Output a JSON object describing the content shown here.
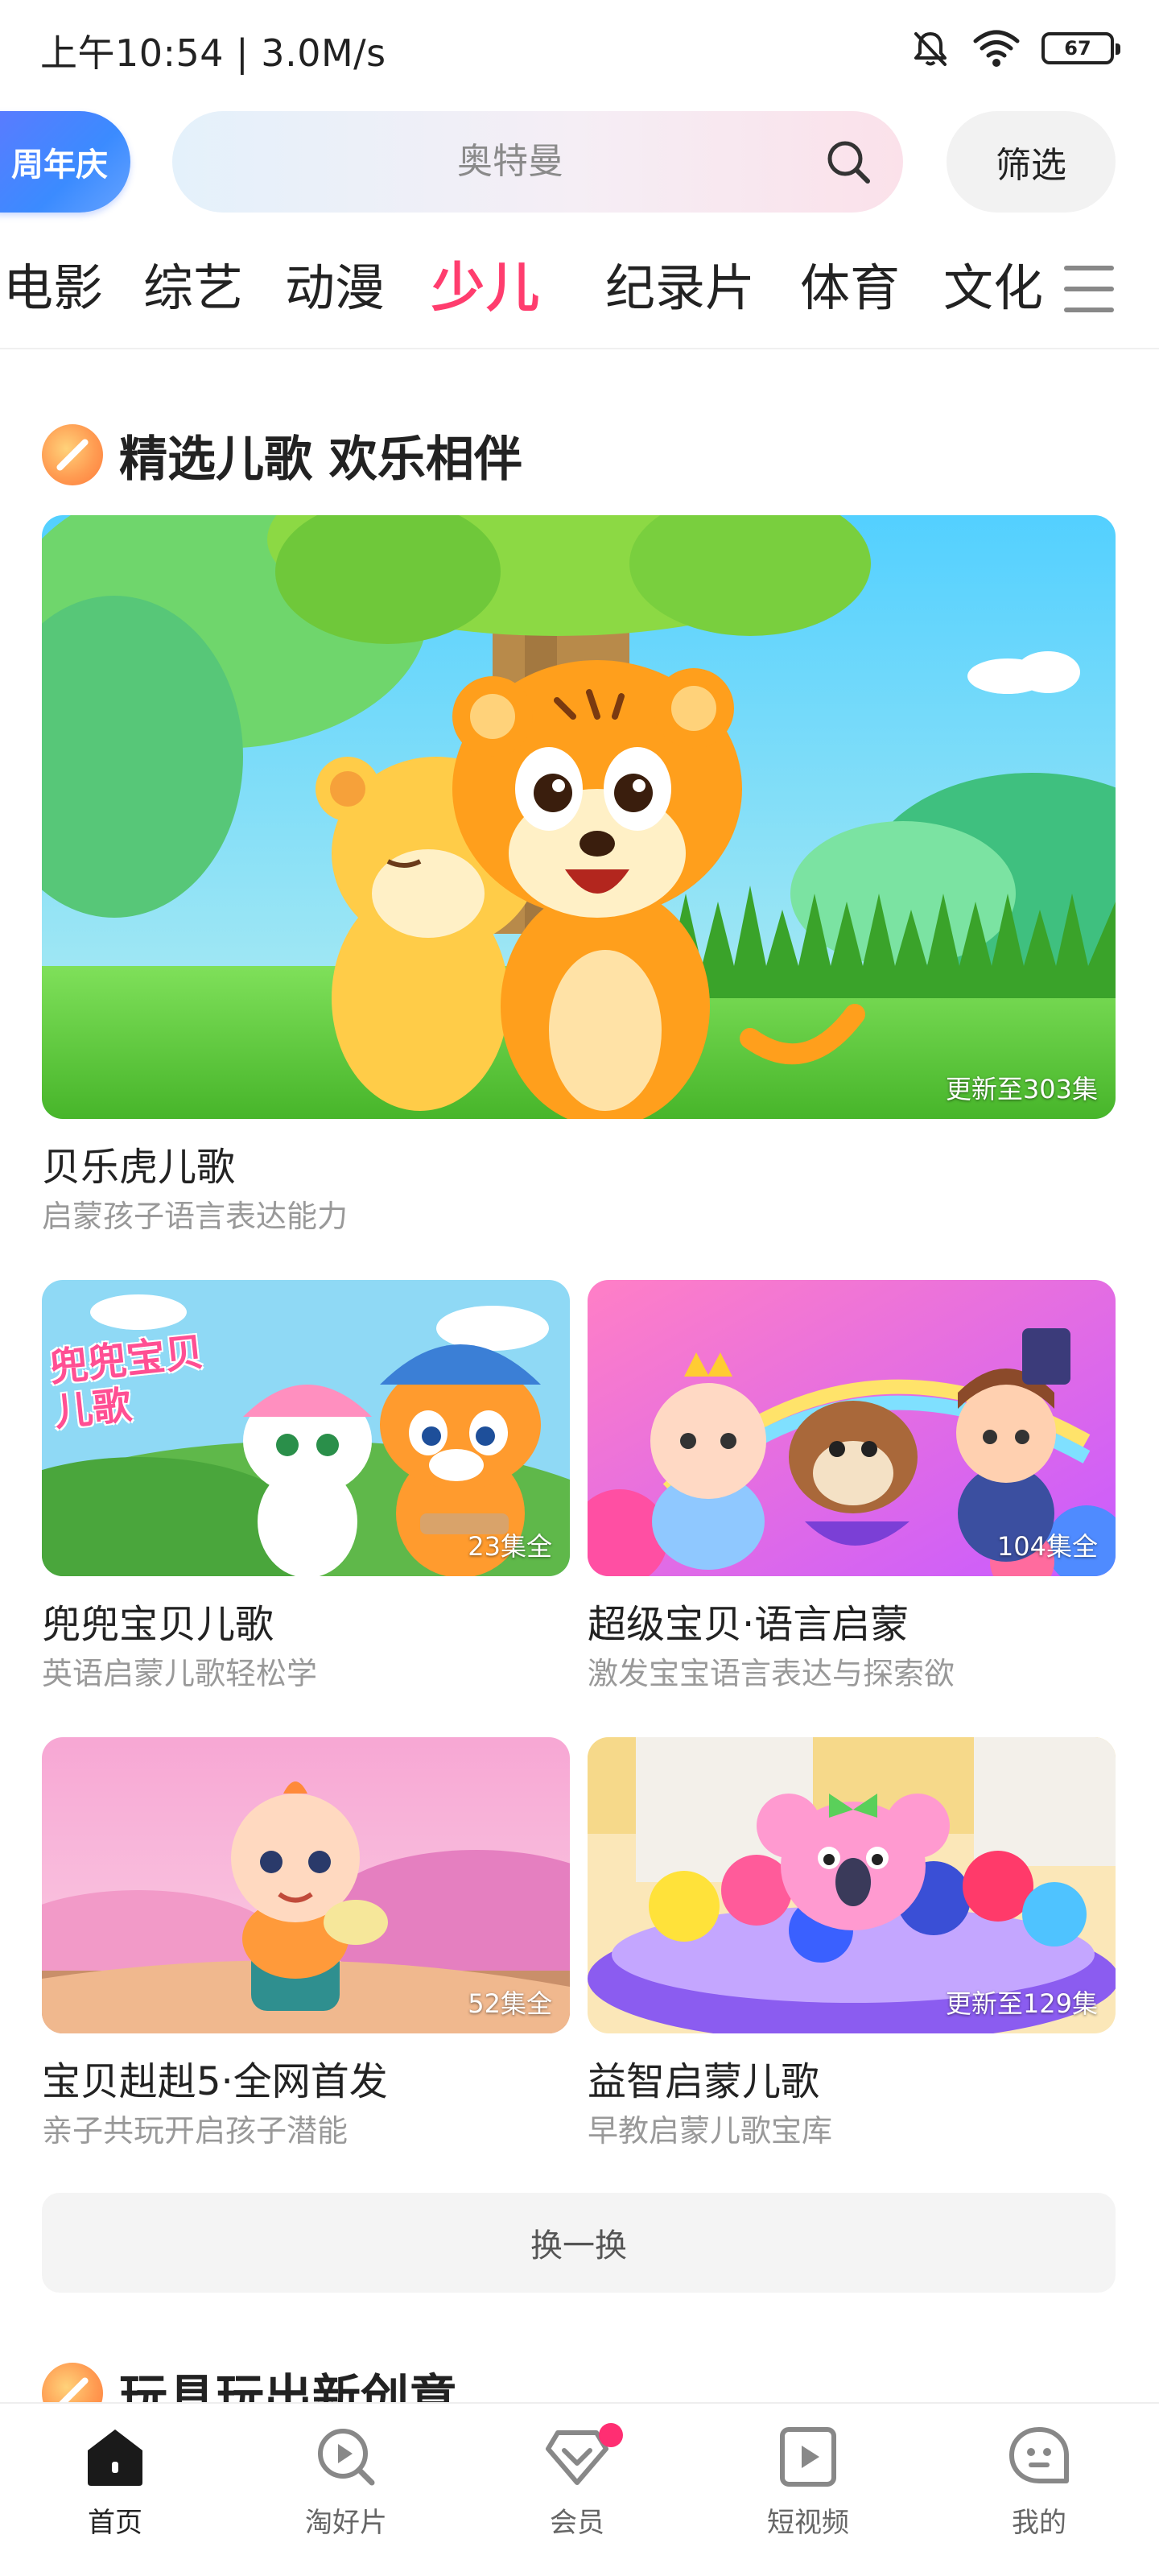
{
  "status_bar": {
    "time": "上午10:54 | 3.0M/s",
    "battery": "67",
    "icons": [
      "mute-bell-icon",
      "wifi-icon",
      "battery-icon"
    ]
  },
  "header": {
    "anniversary_label": "周年庆",
    "search_placeholder": "奥特曼",
    "filter_label": "筛选"
  },
  "categories": {
    "items": [
      "电影",
      "综艺",
      "动漫",
      "少儿",
      "纪录片",
      "体育",
      "文化"
    ],
    "active": "少儿",
    "active_color": "#ff3d6e"
  },
  "section_songs": {
    "title": "精选儿歌 欢乐相伴",
    "featured": {
      "title": "贝乐虎儿歌",
      "subtitle": "启蒙孩子语言表达能力",
      "badge": "更新至303集"
    },
    "cards": [
      {
        "title": "兜兜宝贝儿歌",
        "subtitle": "英语启蒙儿歌轻松学",
        "badge": "23集全",
        "poster_text": "兜兜宝贝儿歌"
      },
      {
        "title": "超级宝贝·语言启蒙",
        "subtitle": "激发宝宝语言表达与探索欲",
        "badge": "104集全"
      },
      {
        "title": "宝贝赳赳5·全网首发",
        "subtitle": "亲子共玩开启孩子潜能",
        "badge": "52集全"
      },
      {
        "title": "益智启蒙儿歌",
        "subtitle": "早教启蒙儿歌宝库",
        "badge": "更新至129集"
      }
    ],
    "refresh_label": "换一换"
  },
  "section_toys": {
    "title": "玩具玩出新创意"
  },
  "tabbar": {
    "items": [
      {
        "label": "首页",
        "icon": "home-icon",
        "active": true
      },
      {
        "label": "淘好片",
        "icon": "discover-icon",
        "active": false
      },
      {
        "label": "会员",
        "icon": "vip-diamond-icon",
        "active": false
      },
      {
        "label": "短视频",
        "icon": "short-video-icon",
        "active": false
      },
      {
        "label": "我的",
        "icon": "profile-chat-icon",
        "active": false
      }
    ]
  }
}
